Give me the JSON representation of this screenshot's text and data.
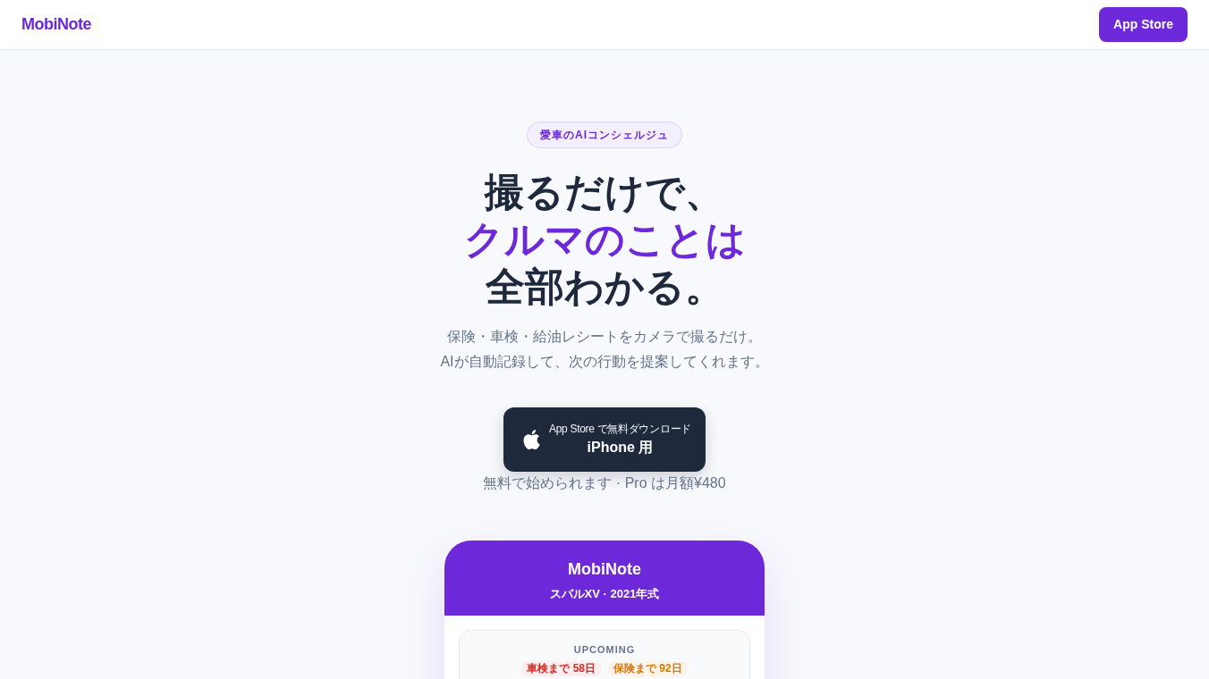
{
  "header": {
    "logo": "MobiNote",
    "button": "App Store"
  },
  "hero": {
    "badge": "愛車のAIコンシェルジュ",
    "headline": [
      {
        "text": "撮るだけで、",
        "accent": false
      },
      {
        "text": "クルマのことは",
        "accent": true
      },
      {
        "text": "全部わかる。",
        "accent": false
      }
    ],
    "description": [
      "保険・車検・給油レシートをカメラで撮るだけ。",
      "AIが自動記録して、次の行動を提案してくれます。"
    ],
    "download": {
      "caption": "App Store で無料ダウンロード",
      "label": "iPhone 用"
    },
    "note": "無料で始められます · Pro は月額¥480"
  },
  "phone": {
    "app_name": "MobiNote",
    "vehicle": "スバルXV · 2021年式",
    "upcoming": {
      "title": "UPCOMING",
      "chips": [
        {
          "text": "車検まで 58日",
          "color": "#dc2626"
        },
        {
          "text": "保険まで 92日",
          "color": "#d97706"
        }
      ]
    }
  }
}
